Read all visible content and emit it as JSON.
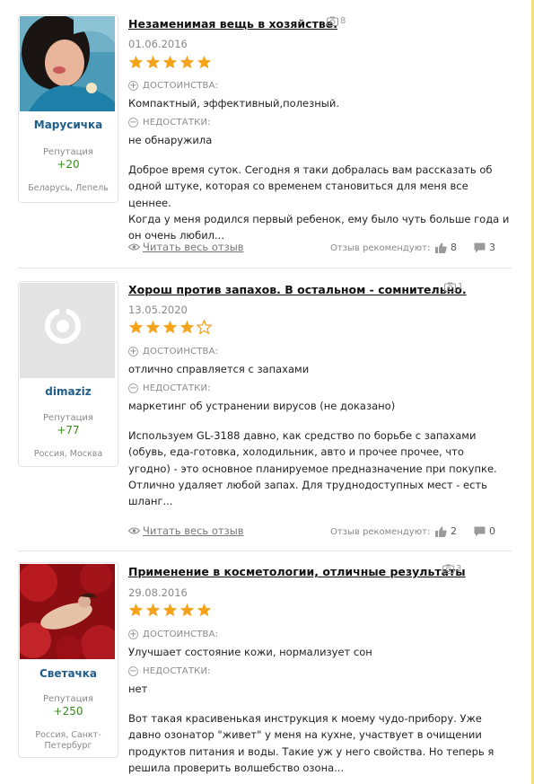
{
  "reviews": [
    {
      "title": "Незаменимая вещь в хозяйстве.",
      "photo_count": "8",
      "date": "01.06.2016",
      "rating": 5,
      "author": "Марусичка",
      "reputation_label": "Репутация",
      "reputation": "+20",
      "location": "Беларусь, Лепель",
      "pros_label": "ДОСТОИНСТВА:",
      "pros": "Компактный, эффективный,полезный.",
      "cons_label": "НЕДОСТАТКИ:",
      "cons": "не обнаружила",
      "body_lines": [
        "Доброе время суток. Сегодня я таки добралась вам рассказать об",
        "одной штуке, которая со временем становиться для меня все ценнее.",
        "Когда у меня родился первый ребенок, ему было чуть больше года и",
        "он очень любил..."
      ],
      "read_more": "Читать весь отзыв",
      "recommend_label": "Отзыв рекомендуют:",
      "likes": "8",
      "comments": "3"
    },
    {
      "title": "Хорош против запахов. В остальном - сомнительно.",
      "photo_count": "1",
      "date": "13.05.2020",
      "rating": 4,
      "author": "dimaziz",
      "reputation_label": "Репутация",
      "reputation": "+77",
      "location": "Россия, Москва",
      "pros_label": "ДОСТОИНСТВА:",
      "pros": "отлично справляется с запахами",
      "cons_label": "НЕДОСТАТКИ:",
      "cons": "маркетинг об устранении вирусов (не доказано)",
      "body_lines": [
        "Используем GL-3188 давно, как средство по борьбе с запахами",
        "(обувь, еда-готовка, холодильник, авто и прочее прочее, что",
        "угодно) - это основное планируемое предназначение при покупке.",
        "Отлично удаляет любой запах. Для труднодоступных мест - есть",
        "шланг..."
      ],
      "read_more": "Читать весь отзыв",
      "recommend_label": "Отзыв рекомендуют:",
      "likes": "2",
      "comments": "0"
    },
    {
      "title": "Применение в косметологии, отличные результаты",
      "photo_count": "3",
      "date": "29.08.2016",
      "rating": 5,
      "author": "Светачка",
      "reputation_label": "Репутация",
      "reputation": "+250",
      "location": "Россия, Санкт-Петербург",
      "pros_label": "ДОСТОИНСТВА:",
      "pros": "Улучшает состояние кожи, нормализует сон",
      "cons_label": "НЕДОСТАТКИ:",
      "cons": "нет",
      "body_lines": [
        "Вот такая красивенькая инструкция к моему чудо-прибору. Уже",
        "давно озонатор \"живет\" у меня на кухне, участвует в очищении",
        "продуктов питания и воды. Такие уж у него свойства. Но теперь я",
        "решила проверить волшебство озона..."
      ],
      "read_more": "",
      "recommend_label": "",
      "likes": "",
      "comments": ""
    }
  ],
  "colors": {
    "star": "#f5a31a",
    "star_empty": "#f5a31a",
    "username": "#1f5e8c",
    "reputation": "#3a8c22",
    "accent_line": "#f2e07a"
  },
  "icons": [
    "camera-icon",
    "plus-circle-icon",
    "minus-circle-icon",
    "eye-icon",
    "thumbs-up-icon",
    "comment-icon",
    "star-icon"
  ]
}
